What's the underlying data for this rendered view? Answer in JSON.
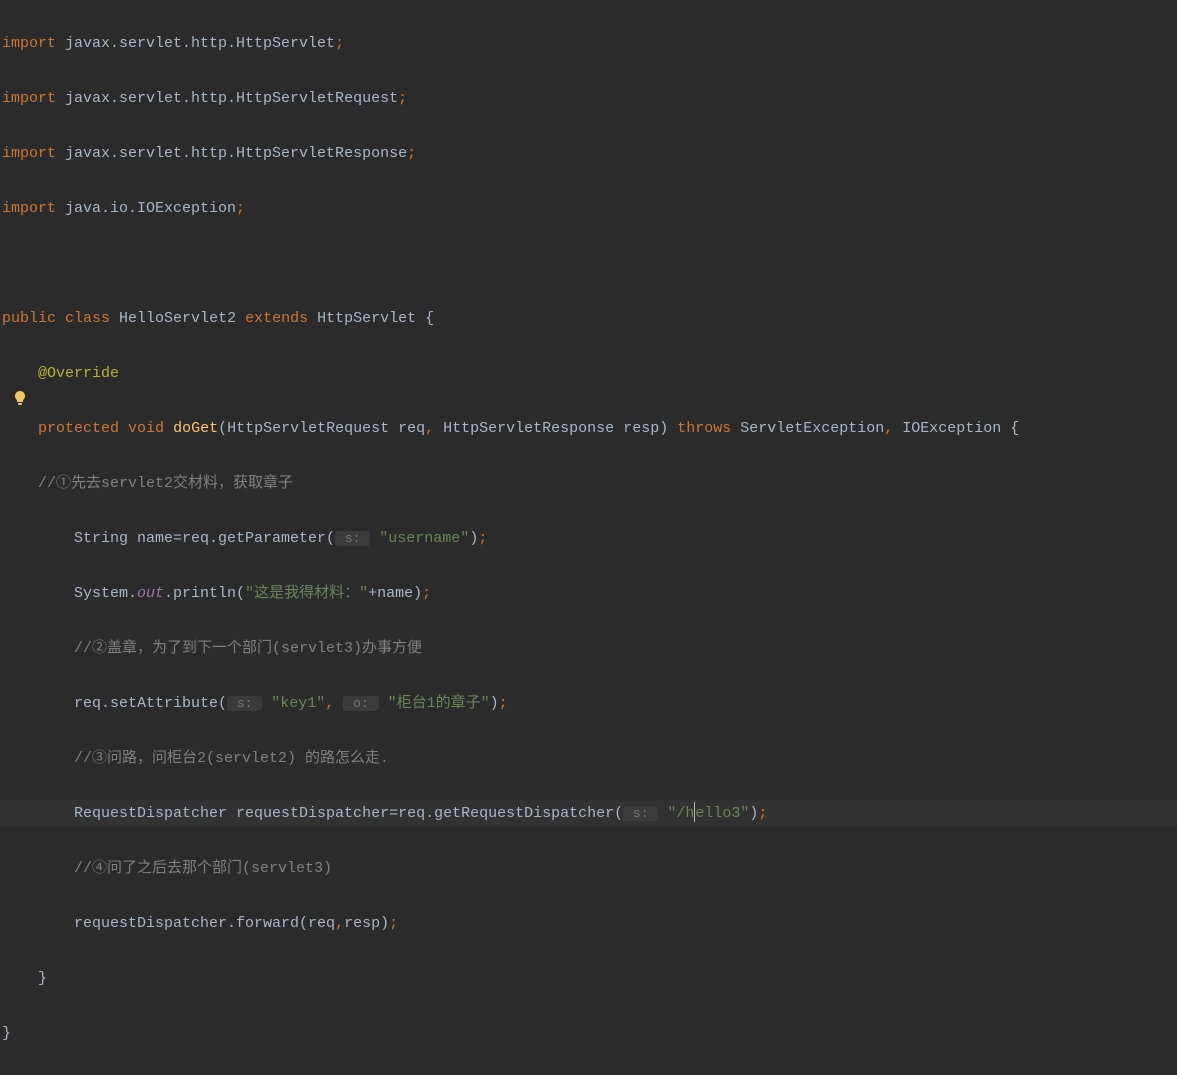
{
  "lines": {
    "l1_import": "import",
    "l1_rest": " javax.servlet.http.HttpServlet",
    "l1_semi": ";",
    "l2_rest": " javax.servlet.http.HttpServletRequest",
    "l3_rest": " javax.servlet.http.HttpServletResponse",
    "l4_rest": " java.io.IOException",
    "l6_public": "public",
    "l6_class": "class",
    "l6_name": " HelloServlet2 ",
    "l6_extends": "extends",
    "l6_parent": " HttpServlet {",
    "l7_ann": "@Override",
    "l8_protected": "protected",
    "l8_void": "void",
    "l8_fn": "doGet",
    "l8_params1": "(HttpServletRequest req",
    "l8_comma": ",",
    "l8_params2": " HttpServletResponse resp) ",
    "l8_throws": "throws",
    "l8_exc": " ServletException",
    "l8_exc2": " IOException {",
    "l9_comment": "//①先去servlet2交材料，获取章子",
    "l10_a": "String name=req.getParameter(",
    "l10_hint": " s: ",
    "l10_str": "\"username\"",
    "l10_b": ")",
    "l10_semi": ";",
    "l11_a": "System.",
    "l11_out": "out",
    "l11_b": ".println(",
    "l11_str": "\"这是我得材料：\"",
    "l11_c": "+name)",
    "l11_semi": ";",
    "l12_comment": "//②盖章，为了到下一个部门(servlet3)办事方便",
    "l13_a": "req.setAttribute(",
    "l13_hint1": " s: ",
    "l13_str1": "\"key1\"",
    "l13_comma": ",",
    "l13_hint2": " o: ",
    "l13_str2": "\"柜台1的章子\"",
    "l13_b": ")",
    "l13_semi": ";",
    "l14_comment": "//③问路，问柜台2(servlet2) 的路怎么走.",
    "l15_a": "RequestDispatcher requestDispatcher=req.getRequestDispatcher(",
    "l15_hint": " s: ",
    "l15_str1": "\"/h",
    "l15_str2": "ello3\"",
    "l15_b": ")",
    "l15_semi": ";",
    "l16_comment": "//④问了之后去那个部门(servlet3)",
    "l17_a": "requestDispatcher.forward(req",
    "l17_comma": ",",
    "l17_b": "resp)",
    "l17_semi": ";",
    "l18_brace": "}",
    "l19_brace": "}"
  },
  "indent1": "    ",
  "indent2": "        "
}
